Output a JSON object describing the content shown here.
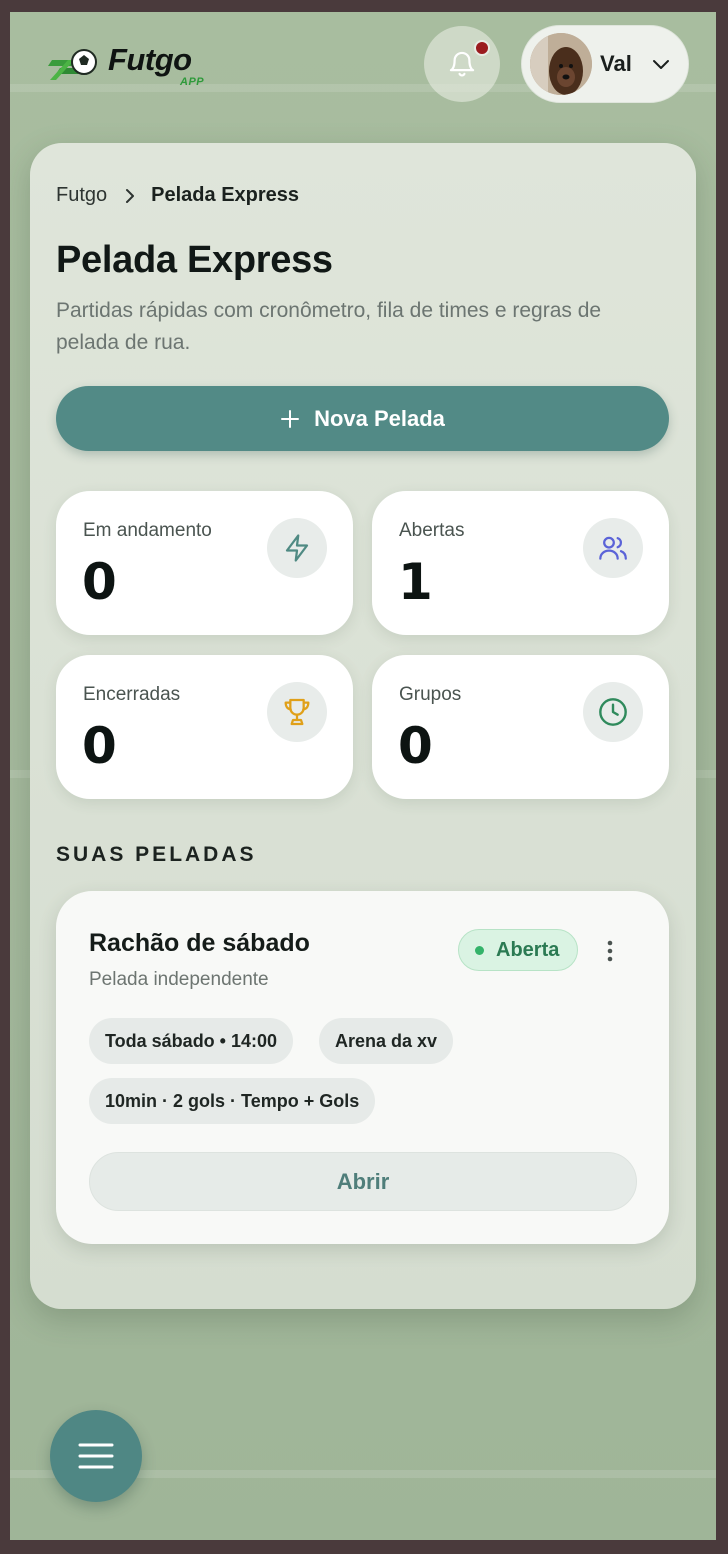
{
  "header": {
    "logo_text": "Futgo",
    "logo_subtext": "APP",
    "notifications_icon": "bell-icon",
    "notification_indicator_color": "#9b1b1f",
    "user": {
      "name": "Val",
      "avatar": "dog-photo-avatar"
    }
  },
  "breadcrumb": {
    "root": "Futgo",
    "current": "Pelada Express"
  },
  "page": {
    "title": "Pelada Express",
    "subtitle": "Partidas rápidas com cronômetro, fila de times e regras de pelada de rua.",
    "new_button_label": "Nova Pelada"
  },
  "stats": [
    {
      "label": "Em andamento",
      "value": "0",
      "icon": "lightning-icon",
      "icon_color": "#4f8a83"
    },
    {
      "label": "Abertas",
      "value": "1",
      "icon": "users-icon",
      "icon_color": "#5b63d8"
    },
    {
      "label": "Encerradas",
      "value": "0",
      "icon": "trophy-icon",
      "icon_color": "#e0a019"
    },
    {
      "label": "Grupos",
      "value": "0",
      "icon": "clock-icon",
      "icon_color": "#2f8a5c"
    }
  ],
  "section_title": "SUAS PELADAS",
  "peladas": [
    {
      "title": "Rachão de sábado",
      "subtitle": "Pelada independente",
      "status": "Aberta",
      "status_color": "#2b7a53",
      "chips": [
        "Toda sábado • 14:00",
        "Arena da xv",
        "10min · 2 gols · Tempo + Gols"
      ],
      "open_label": "Abrir"
    }
  ],
  "menu_icon": "hamburger-menu-icon",
  "colors": {
    "accent": "#528a86",
    "background": "#a7bc9e"
  }
}
